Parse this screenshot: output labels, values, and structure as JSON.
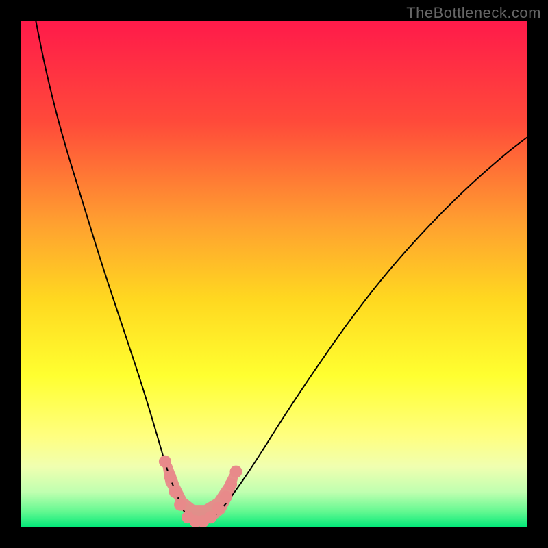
{
  "watermark": "TheBottleneck.com",
  "chart_data": {
    "type": "line",
    "title": "",
    "xlabel": "",
    "ylabel": "",
    "xlim": [
      0,
      100
    ],
    "ylim": [
      0,
      100
    ],
    "background_gradient": {
      "stops": [
        {
          "offset": 0,
          "color": "#ff1a4a"
        },
        {
          "offset": 20,
          "color": "#ff4a3a"
        },
        {
          "offset": 40,
          "color": "#ffa030"
        },
        {
          "offset": 55,
          "color": "#ffd820"
        },
        {
          "offset": 70,
          "color": "#ffff30"
        },
        {
          "offset": 82,
          "color": "#ffff80"
        },
        {
          "offset": 88,
          "color": "#f0ffb0"
        },
        {
          "offset": 93,
          "color": "#c0ffb0"
        },
        {
          "offset": 97,
          "color": "#60f890"
        },
        {
          "offset": 100,
          "color": "#00e878"
        }
      ]
    },
    "series": [
      {
        "name": "bottleneck-curve",
        "color": "#000000",
        "width": 2,
        "x": [
          3,
          5,
          8,
          12,
          16,
          20,
          24,
          27,
          29,
          31,
          32.5,
          34,
          36,
          38,
          40,
          43,
          47,
          52,
          58,
          65,
          72,
          80,
          88,
          96,
          100
        ],
        "values": [
          100,
          90,
          78,
          65,
          52,
          40,
          28,
          18,
          11,
          6,
          2.5,
          1,
          1,
          2,
          4,
          8,
          14,
          22,
          31,
          41,
          50,
          59,
          67,
          74,
          77
        ]
      },
      {
        "name": "highlight-markers",
        "type": "scatter",
        "color": "#e88a8a",
        "size": 9,
        "x": [
          28.5,
          29.5,
          30.5,
          31.5,
          33,
          34.5,
          36,
          37.5,
          39,
          40.5,
          41.5,
          42.5
        ],
        "values": [
          13,
          10,
          7,
          4.5,
          2,
          1.2,
          1.2,
          2,
          3.8,
          6,
          8.5,
          11
        ]
      }
    ],
    "highlight_blob": {
      "pathX": [
        29,
        30.5,
        32.5,
        35,
        37.5,
        39.5,
        41,
        42,
        41,
        39,
        36.5,
        34,
        31.5,
        29.5,
        29
      ],
      "pathY": [
        12,
        8,
        4,
        2,
        2,
        3.5,
        6.5,
        10,
        8,
        5,
        3.5,
        3.5,
        5.5,
        9,
        12
      ],
      "fill": "#e88a8a"
    }
  }
}
